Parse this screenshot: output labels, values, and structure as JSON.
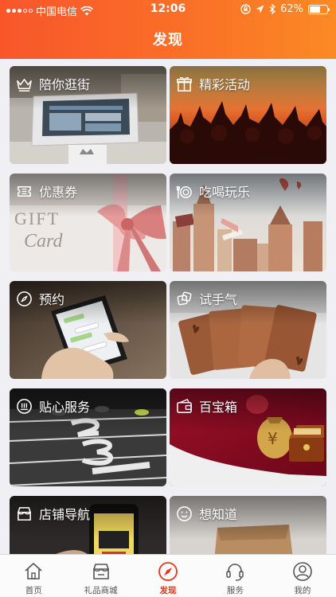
{
  "status_bar": {
    "carrier": "中国电信",
    "time": "12:06",
    "battery": "62%",
    "battery_level": 0.62
  },
  "header": {
    "title": "发现"
  },
  "cards": [
    {
      "label": "陪你逛街",
      "icon": "crown-icon"
    },
    {
      "label": "精彩活动",
      "icon": "gift-box-icon"
    },
    {
      "label": "优惠券",
      "icon": "ticket-icon"
    },
    {
      "label": "吃喝玩乐",
      "icon": "plate-icon"
    },
    {
      "label": "预约",
      "icon": "compass-icon"
    },
    {
      "label": "试手气",
      "icon": "dice-icon"
    },
    {
      "label": "贴心服务",
      "icon": "service-icon"
    },
    {
      "label": "百宝箱",
      "icon": "wallet-icon"
    },
    {
      "label": "店铺导航",
      "icon": "store-icon"
    },
    {
      "label": "想知道",
      "icon": "smile-icon"
    }
  ],
  "card_art": {
    "gift_text": "GIFT",
    "card_text": "Card"
  },
  "tabbar": [
    {
      "label": "首页",
      "icon": "home-icon",
      "active": false
    },
    {
      "label": "礼品商城",
      "icon": "shop-icon",
      "active": false
    },
    {
      "label": "发现",
      "icon": "compass-icon",
      "active": true
    },
    {
      "label": "服务",
      "icon": "headset-icon",
      "active": false
    },
    {
      "label": "我的",
      "icon": "user-icon",
      "active": false
    }
  ],
  "colors": {
    "header_start": "#f8562a",
    "header_end": "#fb8a24",
    "tab_active": "#e8341c"
  }
}
